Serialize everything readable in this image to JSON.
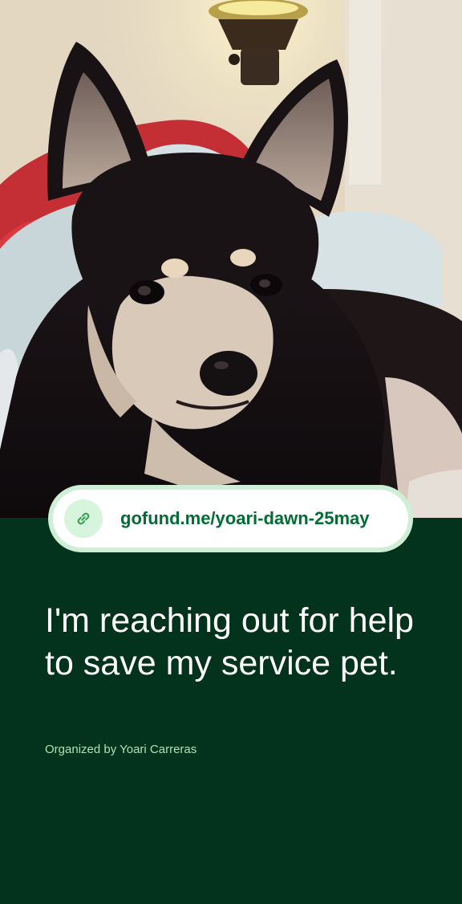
{
  "photo": {
    "subject": "chihuahua-dog-photo"
  },
  "link": {
    "icon": "link-icon",
    "url_text": "gofund.me/yoari-dawn-25may"
  },
  "campaign": {
    "headline": "I'm reaching out for help to save my service pet.",
    "organizer": "Organized by Yoari Carreras"
  },
  "colors": {
    "panel_background": "#03331c",
    "link_text": "#016d33",
    "link_border": "#cfeed6",
    "icon_circle": "#d7f4dc",
    "headline_text": "#ffffff",
    "organizer_text": "#a9e3b4"
  }
}
